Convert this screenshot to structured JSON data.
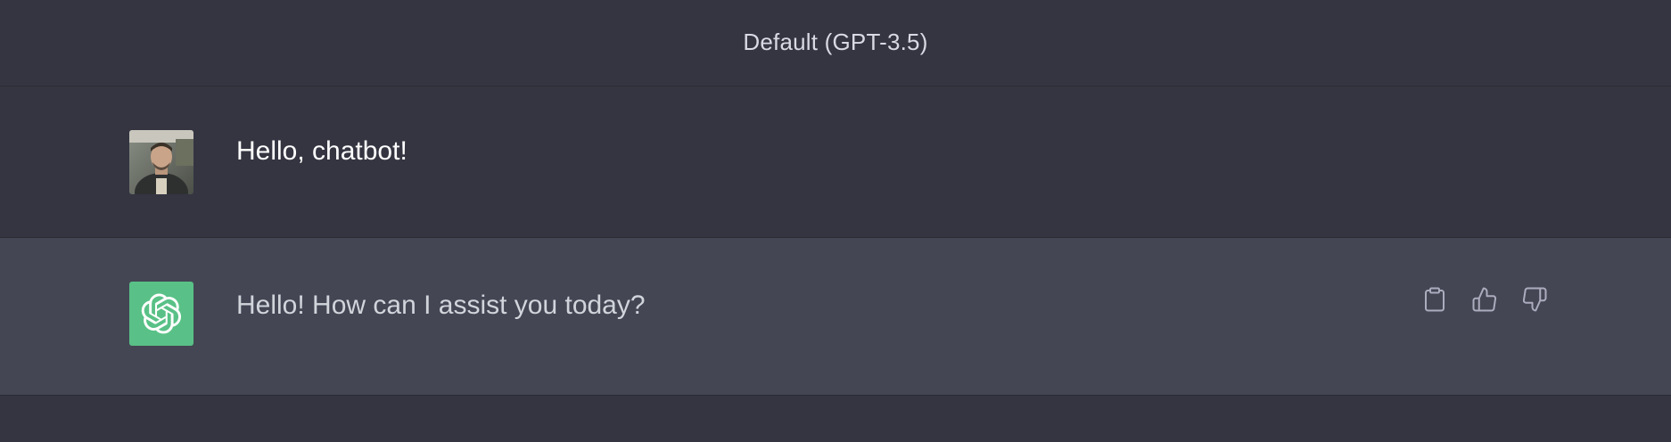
{
  "header": {
    "model_title": "Default (GPT-3.5)"
  },
  "conversation": {
    "messages": [
      {
        "role": "user",
        "avatar_icon": "user-photo-avatar",
        "text": "Hello, chatbot!"
      },
      {
        "role": "assistant",
        "avatar_icon": "openai-logo-icon",
        "avatar_color": "#59c187",
        "text": "Hello! How can I assist you today?",
        "actions": [
          {
            "name": "copy",
            "icon": "clipboard-icon"
          },
          {
            "name": "thumbs-up",
            "icon": "thumbs-up-icon"
          },
          {
            "name": "thumbs-down",
            "icon": "thumbs-down-icon"
          }
        ]
      }
    ]
  },
  "colors": {
    "background": "#343541",
    "assistant_row": "#444654",
    "accent_green": "#59c187",
    "icon_gray": "#acacbe"
  }
}
